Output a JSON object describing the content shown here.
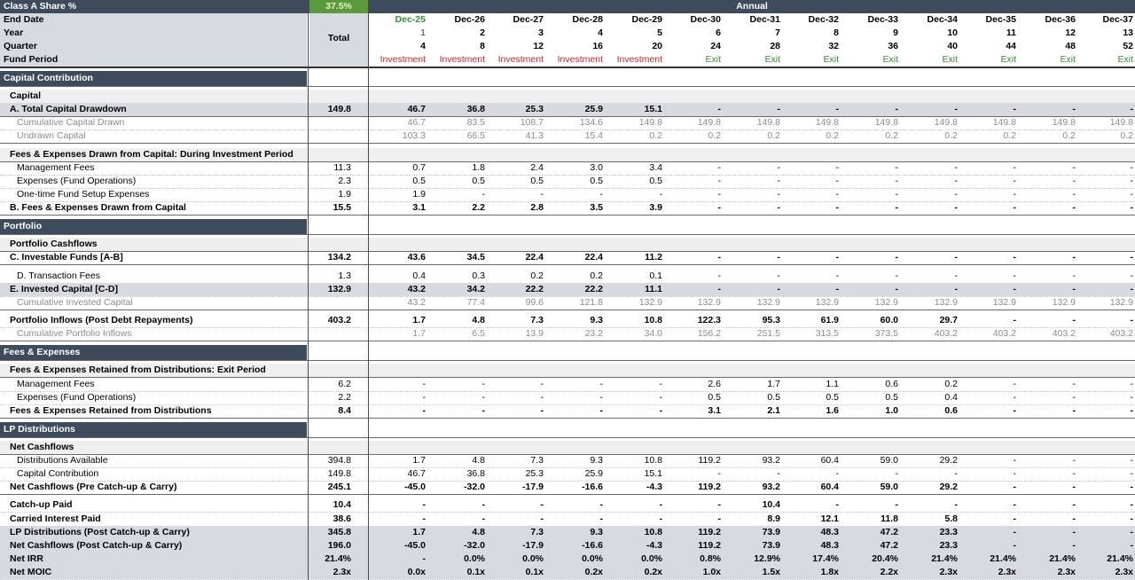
{
  "header": {
    "share_label": "Class A Share %",
    "share_value": "37.5%",
    "annual_label": "Annual",
    "total_label": "Total",
    "row_labels": {
      "end_date": "End Date",
      "year": "Year",
      "quarter": "Quarter",
      "fund_period": "Fund Period"
    },
    "dates": [
      "Dec-25",
      "Dec-26",
      "Dec-27",
      "Dec-28",
      "Dec-29",
      "Dec-30",
      "Dec-31",
      "Dec-32",
      "Dec-33",
      "Dec-34",
      "Dec-35",
      "Dec-36",
      "Dec-37"
    ],
    "years": [
      "1",
      "2",
      "3",
      "4",
      "5",
      "6",
      "7",
      "8",
      "9",
      "10",
      "11",
      "12",
      "13"
    ],
    "quarters": [
      "4",
      "8",
      "12",
      "16",
      "20",
      "24",
      "28",
      "32",
      "36",
      "40",
      "44",
      "48",
      "52"
    ],
    "periods": [
      "Investment",
      "Investment",
      "Investment",
      "Investment",
      "Investment",
      "Exit",
      "Exit",
      "Exit",
      "Exit",
      "Exit",
      "Exit",
      "Exit",
      "Exit"
    ]
  },
  "colors": {
    "section_bar": "#3d4b5d",
    "share_highlight": "#5a9a3c",
    "investment": "#c0262d",
    "exit": "#3a8a3a",
    "year1": "#1b34c9"
  },
  "sections": {
    "capital_contribution": "Capital Contribution",
    "portfolio": "Portfolio",
    "fees_expenses": "Fees & Expenses",
    "lp_distributions": "LP Distributions"
  },
  "rows": [
    {
      "id": "capital-sub",
      "label": "Capital",
      "total": "",
      "values": [],
      "style": "sub"
    },
    {
      "id": "total-capital-drawdown",
      "label": "A. Total Capital Drawdown",
      "total": "149.8",
      "values": [
        "46.7",
        "36.8",
        "25.3",
        "25.9",
        "15.1",
        "-",
        "-",
        "-",
        "-",
        "-",
        "-",
        "-",
        "-"
      ],
      "style": "boldgrey"
    },
    {
      "id": "cumulative-capital-drawn",
      "label": "Cumulative Capital Drawn",
      "total": "",
      "values": [
        "46.7",
        "83.5",
        "108.7",
        "134.6",
        "149.8",
        "149.8",
        "149.8",
        "149.8",
        "149.8",
        "149.8",
        "149.8",
        "149.8",
        "149.8"
      ],
      "style": "muted"
    },
    {
      "id": "undrawn-capital",
      "label": "Undrawn Capital",
      "total": "",
      "values": [
        "103.3",
        "66.5",
        "41.3",
        "15.4",
        "0.2",
        "0.2",
        "0.2",
        "0.2",
        "0.2",
        "0.2",
        "0.2",
        "0.2",
        "0.2"
      ],
      "style": "muted"
    },
    {
      "id": "fees-drawn-sub",
      "label": "Fees & Expenses Drawn from Capital: During Investment Period",
      "total": "",
      "values": [],
      "style": "sub"
    },
    {
      "id": "management-fees-1",
      "label": "Management Fees",
      "total": "11.3",
      "values": [
        "0.7",
        "1.8",
        "2.4",
        "3.0",
        "3.4",
        "-",
        "-",
        "-",
        "-",
        "-",
        "-",
        "-",
        "-"
      ],
      "style": "plain"
    },
    {
      "id": "expenses-fund-ops-1",
      "label": "Expenses (Fund Operations)",
      "total": "2.3",
      "values": [
        "0.5",
        "0.5",
        "0.5",
        "0.5",
        "0.5",
        "-",
        "-",
        "-",
        "-",
        "-",
        "-",
        "-",
        "-"
      ],
      "style": "plain"
    },
    {
      "id": "one-time-setup",
      "label": "One-time Fund Setup Expenses",
      "total": "1.9",
      "values": [
        "1.9",
        "-",
        "-",
        "-",
        "-",
        "-",
        "-",
        "-",
        "-",
        "-",
        "-",
        "-",
        "-"
      ],
      "style": "plain"
    },
    {
      "id": "fees-drawn-total",
      "label": "B. Fees & Expenses Drawn from Capital",
      "total": "15.5",
      "values": [
        "3.1",
        "2.2",
        "2.8",
        "3.5",
        "3.9",
        "-",
        "-",
        "-",
        "-",
        "-",
        "-",
        "-",
        "-"
      ],
      "style": "bold"
    },
    {
      "id": "portfolio-cashflows-sub",
      "label": "Portfolio Cashflows",
      "total": "",
      "values": [],
      "style": "sub"
    },
    {
      "id": "investable-funds",
      "label": "C. Investable Funds [A-B]",
      "total": "134.2",
      "values": [
        "43.6",
        "34.5",
        "22.4",
        "22.4",
        "11.2",
        "-",
        "-",
        "-",
        "-",
        "-",
        "-",
        "-",
        "-"
      ],
      "style": "bold"
    },
    {
      "id": "transaction-fees",
      "label": "D. Transaction Fees",
      "total": "1.3",
      "values": [
        "0.4",
        "0.3",
        "0.2",
        "0.2",
        "0.1",
        "-",
        "-",
        "-",
        "-",
        "-",
        "-",
        "-",
        "-"
      ],
      "style": "plain"
    },
    {
      "id": "invested-capital",
      "label": "E. Invested Capital [C-D]",
      "total": "132.9",
      "values": [
        "43.2",
        "34.2",
        "22.2",
        "22.2",
        "11.1",
        "-",
        "-",
        "-",
        "-",
        "-",
        "-",
        "-",
        "-"
      ],
      "style": "boldgrey"
    },
    {
      "id": "cumulative-invested-capital",
      "label": "Cumulative Invested Capital",
      "total": "",
      "values": [
        "43.2",
        "77.4",
        "99.6",
        "121.8",
        "132.9",
        "132.9",
        "132.9",
        "132.9",
        "132.9",
        "132.9",
        "132.9",
        "132.9",
        "132.9"
      ],
      "style": "muted"
    },
    {
      "id": "portfolio-inflows",
      "label": "Portfolio Inflows (Post Debt Repayments)",
      "total": "403.2",
      "values": [
        "1.7",
        "4.8",
        "7.3",
        "9.3",
        "10.8",
        "122.3",
        "95.3",
        "61.9",
        "60.0",
        "29.7",
        "-",
        "-",
        "-"
      ],
      "style": "bold"
    },
    {
      "id": "cumulative-portfolio-inflows",
      "label": "Cumulative Portfolio Inflows",
      "total": "",
      "values": [
        "1.7",
        "6.5",
        "13.9",
        "23.2",
        "34.0",
        "156.2",
        "251.5",
        "313.5",
        "373.5",
        "403.2",
        "403.2",
        "403.2",
        "403.2"
      ],
      "style": "muted"
    },
    {
      "id": "fees-retained-sub",
      "label": "Fees & Expenses Retained from Distributions: Exit Period",
      "total": "",
      "values": [],
      "style": "sub"
    },
    {
      "id": "management-fees-2",
      "label": "Management Fees",
      "total": "6.2",
      "values": [
        "-",
        "-",
        "-",
        "-",
        "-",
        "2.6",
        "1.7",
        "1.1",
        "0.6",
        "0.2",
        "-",
        "-",
        "-"
      ],
      "style": "plain"
    },
    {
      "id": "expenses-fund-ops-2",
      "label": "Expenses (Fund Operations)",
      "total": "2.2",
      "values": [
        "-",
        "-",
        "-",
        "-",
        "-",
        "0.5",
        "0.5",
        "0.5",
        "0.5",
        "0.4",
        "-",
        "-",
        "-"
      ],
      "style": "plain"
    },
    {
      "id": "fees-retained-total",
      "label": "Fees & Expenses Retained from Distributions",
      "total": "8.4",
      "values": [
        "-",
        "-",
        "-",
        "-",
        "-",
        "3.1",
        "2.1",
        "1.6",
        "1.0",
        "0.6",
        "-",
        "-",
        "-"
      ],
      "style": "bold"
    },
    {
      "id": "net-cashflows-sub",
      "label": "Net Cashflows",
      "total": "",
      "values": [],
      "style": "sub"
    },
    {
      "id": "distributions-available",
      "label": "Distributions Available",
      "total": "394.8",
      "values": [
        "1.7",
        "4.8",
        "7.3",
        "9.3",
        "10.8",
        "119.2",
        "93.2",
        "60.4",
        "59.0",
        "29.2",
        "-",
        "-",
        "-"
      ],
      "style": "plain"
    },
    {
      "id": "capital-contribution",
      "label": "Capital Contribution",
      "total": "149.8",
      "values": [
        "46.7",
        "36.8",
        "25.3",
        "25.9",
        "15.1",
        "-",
        "-",
        "-",
        "-",
        "-",
        "-",
        "-",
        "-"
      ],
      "style": "plain"
    },
    {
      "id": "net-cashflows-pre",
      "label": "Net Cashflows (Pre Catch-up & Carry)",
      "total": "245.1",
      "values": [
        "-45.0",
        "-32.0",
        "-17.9",
        "-16.6",
        "-4.3",
        "119.2",
        "93.2",
        "60.4",
        "59.0",
        "29.2",
        "-",
        "-",
        "-"
      ],
      "style": "bold"
    },
    {
      "id": "catch-up-paid",
      "label": "Catch-up Paid",
      "total": "10.4",
      "values": [
        "-",
        "-",
        "-",
        "-",
        "-",
        "-",
        "10.4",
        "-",
        "-",
        "-",
        "-",
        "-",
        "-"
      ],
      "style": "bold"
    },
    {
      "id": "carried-interest-paid",
      "label": "Carried Interest Paid",
      "total": "38.6",
      "values": [
        "-",
        "-",
        "-",
        "-",
        "-",
        "-",
        "8.9",
        "12.1",
        "11.8",
        "5.8",
        "-",
        "-",
        "-"
      ],
      "style": "bold"
    },
    {
      "id": "lp-distributions-post",
      "label": "LP Distributions (Post Catch-up & Carry)",
      "total": "345.8",
      "values": [
        "1.7",
        "4.8",
        "7.3",
        "9.3",
        "10.8",
        "119.2",
        "73.9",
        "48.3",
        "47.2",
        "23.3",
        "-",
        "-",
        "-"
      ],
      "style": "boldgrey"
    },
    {
      "id": "net-cashflows-post",
      "label": "Net Cashflows (Post Catch-up & Carry)",
      "total": "196.0",
      "values": [
        "-45.0",
        "-32.0",
        "-17.9",
        "-16.6",
        "-4.3",
        "119.2",
        "73.9",
        "48.3",
        "47.2",
        "23.3",
        "-",
        "-",
        "-"
      ],
      "style": "boldgrey"
    },
    {
      "id": "net-irr",
      "label": "Net IRR",
      "total": "21.4%",
      "values": [
        "-",
        "0.0%",
        "0.0%",
        "0.0%",
        "0.0%",
        "0.8%",
        "12.9%",
        "17.4%",
        "20.4%",
        "21.4%",
        "21.4%",
        "21.4%",
        "21.4%"
      ],
      "style": "boldgrey"
    },
    {
      "id": "net-moic",
      "label": "Net MOIC",
      "total": "2.3x",
      "values": [
        "0.0x",
        "0.1x",
        "0.1x",
        "0.2x",
        "0.2x",
        "1.0x",
        "1.5x",
        "1.8x",
        "2.2x",
        "2.3x",
        "2.3x",
        "2.3x",
        "2.3x"
      ],
      "style": "boldgrey"
    }
  ]
}
